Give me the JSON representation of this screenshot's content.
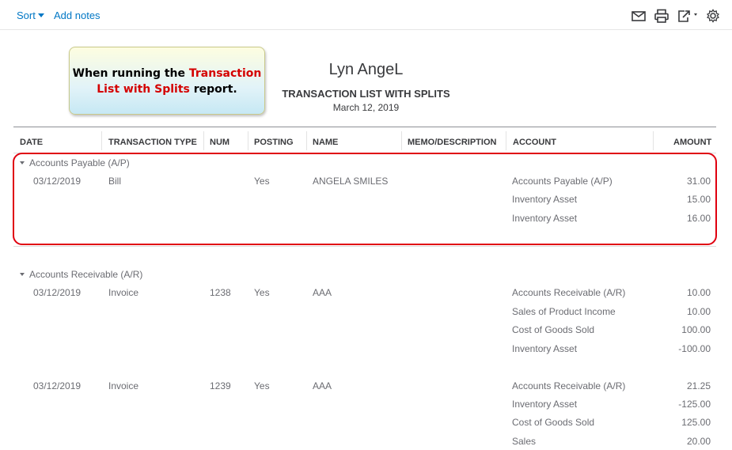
{
  "toolbar": {
    "sort_label": "Sort",
    "add_notes_label": "Add notes",
    "icons": [
      "email-icon",
      "print-icon",
      "export-icon",
      "settings-icon"
    ]
  },
  "callout": {
    "part1": "When running the ",
    "highlight1": "Transaction",
    "highlight2": "List with Splits",
    "part2": " report."
  },
  "report": {
    "company": "Lyn AngeL",
    "title": "TRANSACTION LIST WITH SPLITS",
    "date": "March 12, 2019"
  },
  "columns": [
    "DATE",
    "TRANSACTION TYPE",
    "NUM",
    "POSTING",
    "NAME",
    "MEMO/DESCRIPTION",
    "ACCOUNT",
    "AMOUNT"
  ],
  "groups": [
    {
      "name": "Accounts Payable (A/P)",
      "transactions": [
        {
          "date": "03/12/2019",
          "type": "Bill",
          "num": "",
          "posting": "Yes",
          "name": "ANGELA SMILES",
          "splits": [
            {
              "account": "Accounts Payable (A/P)",
              "amount": "31.00"
            },
            {
              "account": "Inventory Asset",
              "amount": "15.00"
            },
            {
              "account": "Inventory Asset",
              "amount": "16.00"
            }
          ]
        }
      ]
    },
    {
      "name": "Accounts Receivable (A/R)",
      "transactions": [
        {
          "date": "03/12/2019",
          "type": "Invoice",
          "num": "1238",
          "posting": "Yes",
          "name": "AAA",
          "splits": [
            {
              "account": "Accounts Receivable (A/R)",
              "amount": "10.00"
            },
            {
              "account": "Sales of Product Income",
              "amount": "10.00"
            },
            {
              "account": "Cost of Goods Sold",
              "amount": "100.00"
            },
            {
              "account": "Inventory Asset",
              "amount": "-100.00"
            }
          ]
        },
        {
          "date": "03/12/2019",
          "type": "Invoice",
          "num": "1239",
          "posting": "Yes",
          "name": "AAA",
          "splits": [
            {
              "account": "Accounts Receivable (A/R)",
              "amount": "21.25"
            },
            {
              "account": "Inventory Asset",
              "amount": "-125.00"
            },
            {
              "account": "Cost of Goods Sold",
              "amount": "125.00"
            },
            {
              "account": "Sales",
              "amount": "20.00"
            }
          ]
        }
      ]
    }
  ]
}
